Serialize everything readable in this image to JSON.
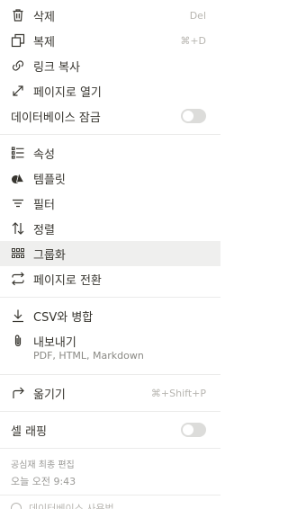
{
  "menu": {
    "delete": {
      "label": "삭제",
      "shortcut": "Del",
      "icon": "trash-icon"
    },
    "duplicate": {
      "label": "복제",
      "shortcut": "⌘+D",
      "icon": "duplicate-icon"
    },
    "copy_link": {
      "label": "링크 복사",
      "icon": "link-icon"
    },
    "open_as_page": {
      "label": "페이지로 열기",
      "icon": "expand-arrow-icon"
    },
    "lock_database": {
      "label": "데이터베이스 잠금",
      "enabled": false
    },
    "properties": {
      "label": "속성",
      "icon": "list-icon"
    },
    "templates": {
      "label": "템플릿",
      "icon": "shapes-icon"
    },
    "filter": {
      "label": "필터",
      "icon": "filter-icon"
    },
    "sort": {
      "label": "정렬",
      "icon": "sort-arrows-icon"
    },
    "group": {
      "label": "그룹화",
      "icon": "group-icon",
      "highlighted": true
    },
    "turn_into_page": {
      "label": "페이지로 전환",
      "icon": "swap-arrows-icon"
    },
    "merge_csv": {
      "label": "CSV와 병합",
      "icon": "import-arrow-icon"
    },
    "export": {
      "label": "내보내기",
      "sublabel": "PDF, HTML, Markdown",
      "icon": "paperclip-icon"
    },
    "move_to": {
      "label": "옮기기",
      "shortcut": "⌘+Shift+P",
      "icon": "move-arrow-icon"
    },
    "wrap_cells": {
      "label": "셀 래핑",
      "enabled": false
    }
  },
  "footer": {
    "last_edited_by": "공심재 최종 편집",
    "last_edited_time": "오늘 오전 9:43",
    "learn_more": "데이터베이스 사용법"
  }
}
